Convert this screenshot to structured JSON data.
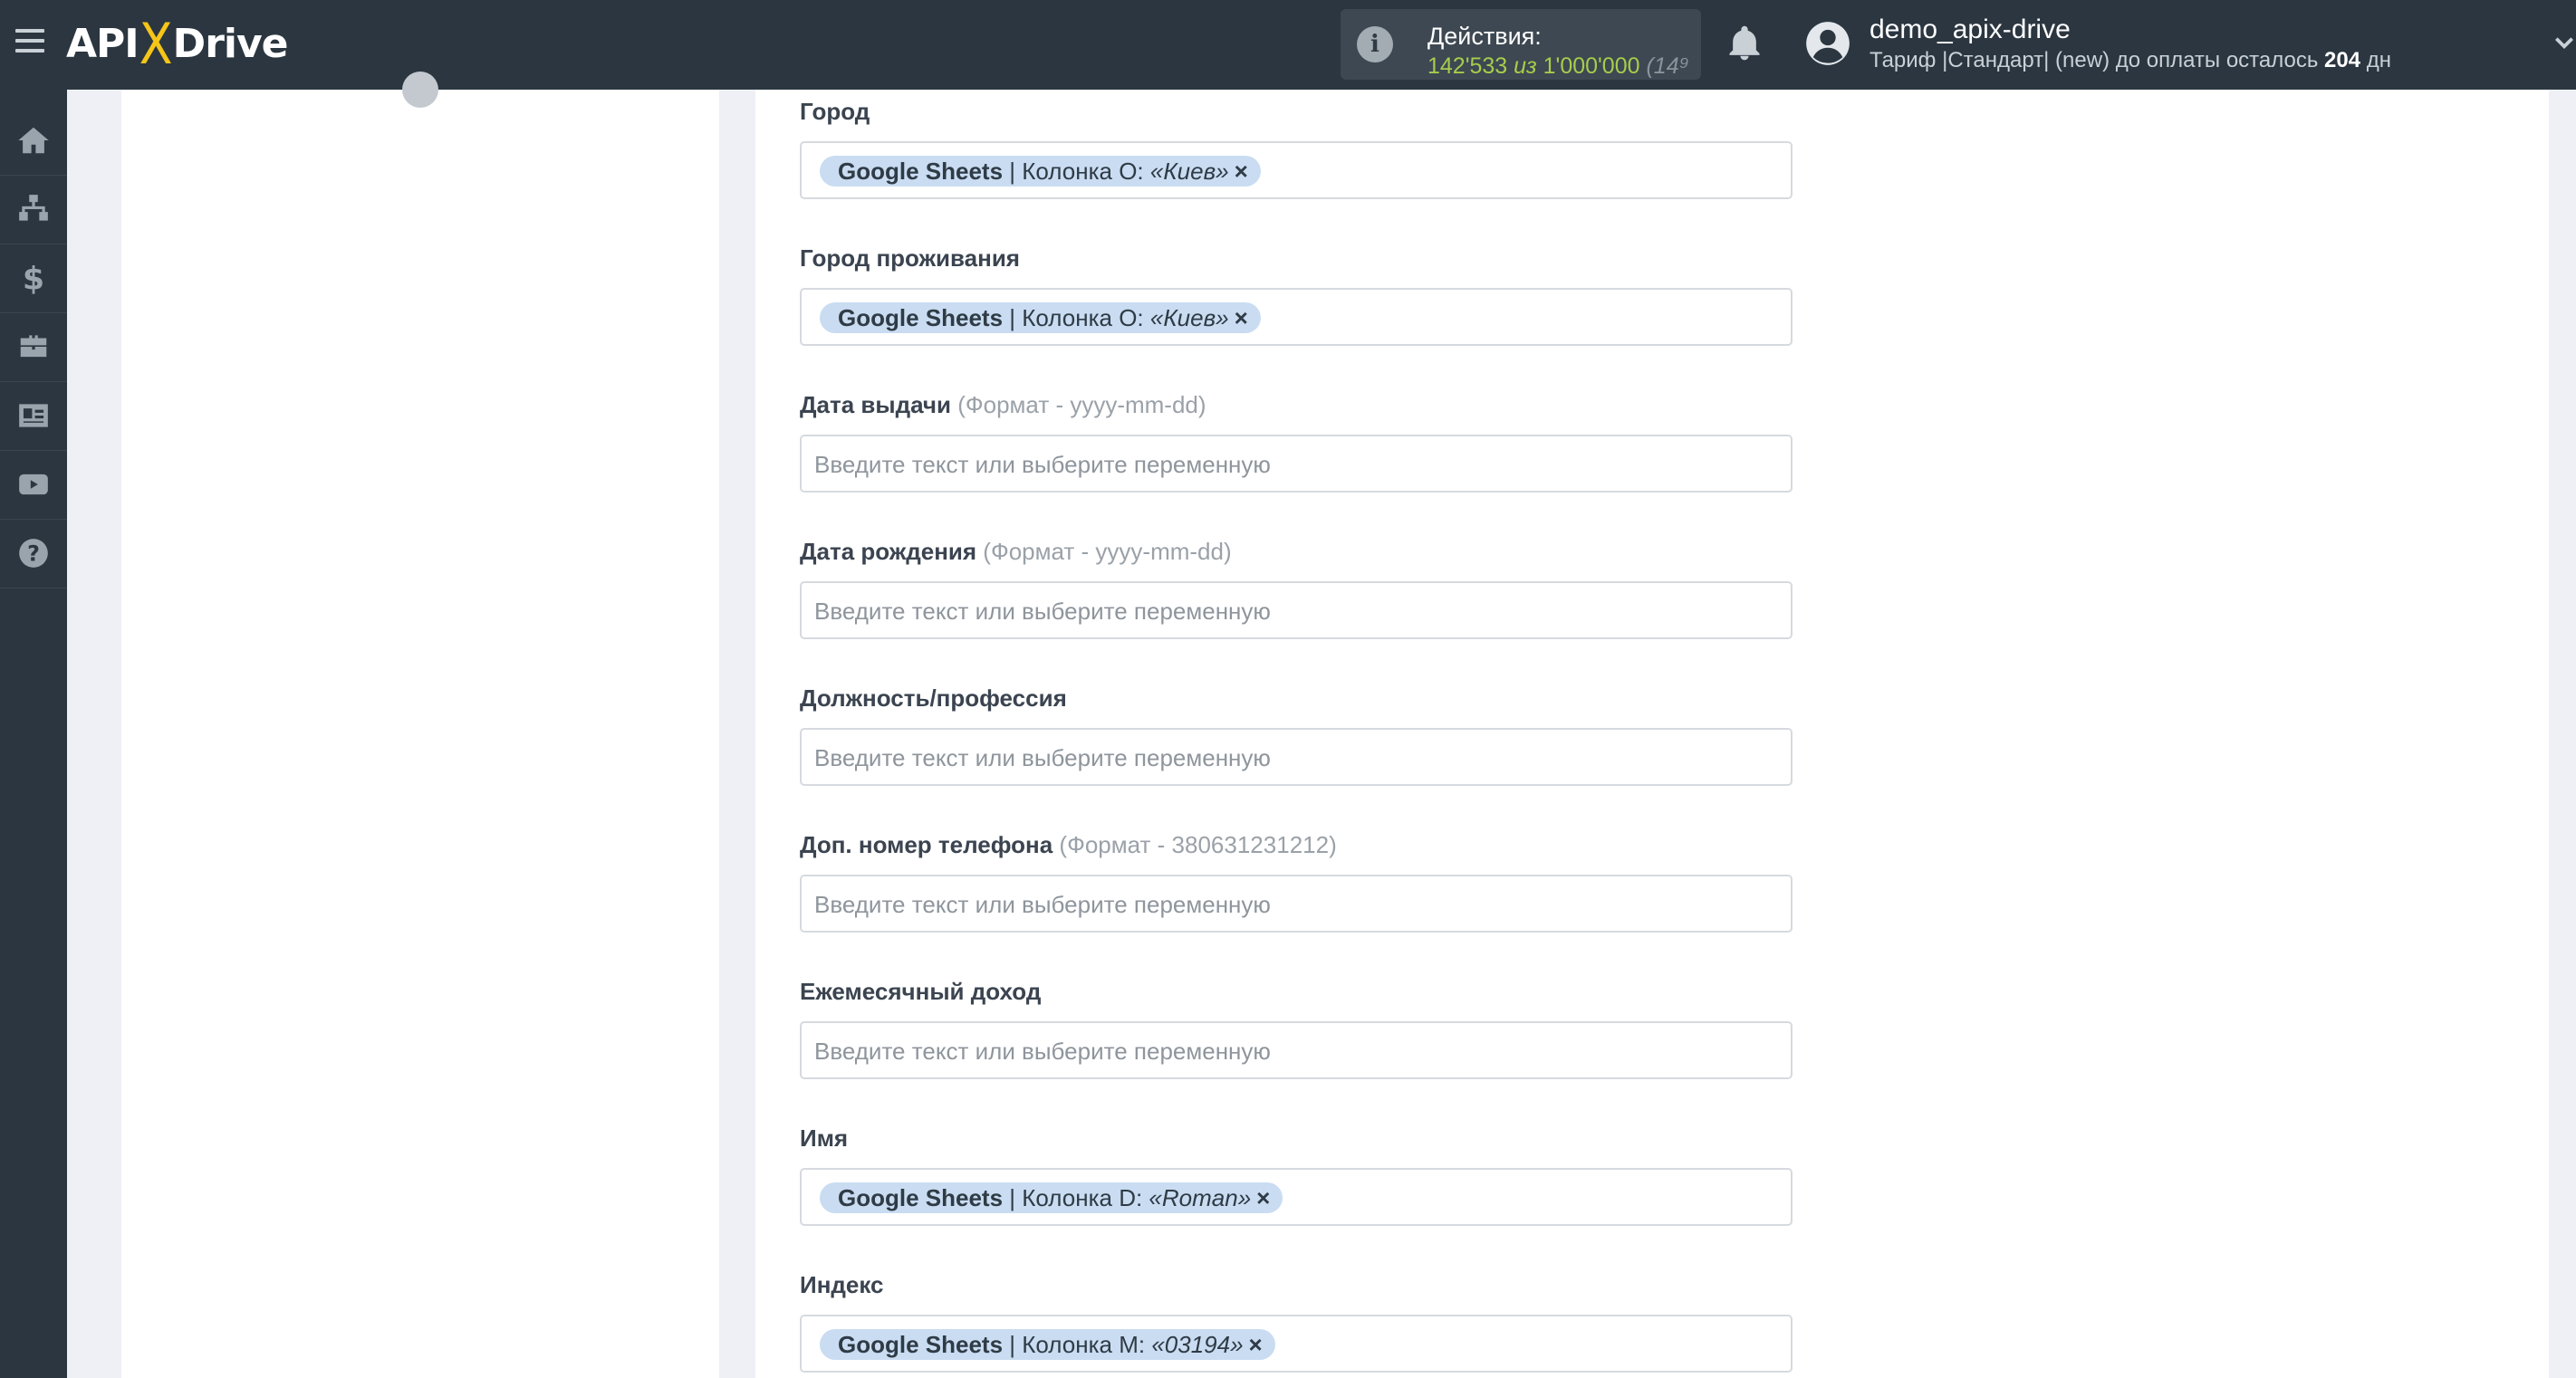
{
  "header": {
    "logo_left": "API",
    "logo_x": "X",
    "logo_right": "Drive",
    "actions_title": "Действия:",
    "actions_used": "142'533",
    "actions_of": "из",
    "actions_total": "1'000'000",
    "actions_rest": "(14⁹",
    "username": "demo_apix-drive",
    "tariff_prefix": "Тариф |Стандарт| (new) до оплаты осталось",
    "tariff_days": "204",
    "tariff_suffix": "дн"
  },
  "sidebar": {
    "items": [
      "home-icon",
      "sitemap-icon",
      "dollar-icon",
      "briefcase-icon",
      "id-card-icon",
      "video-icon",
      "help-icon"
    ]
  },
  "form": {
    "fields": [
      {
        "label": "Город",
        "hint": "",
        "tag": {
          "source": "Google Sheets",
          "column": " | Колонка O: ",
          "value": "«Киев»",
          "remove": "×"
        }
      },
      {
        "label": "Город проживания",
        "hint": "",
        "tag": {
          "source": "Google Sheets",
          "column": " | Колонка O: ",
          "value": "«Киев»",
          "remove": "×"
        }
      },
      {
        "label": "Дата выдачи",
        "hint": " (Формат - yyyy-mm-dd)",
        "placeholder": "Введите текст или выберите переменную"
      },
      {
        "label": "Дата рождения",
        "hint": " (Формат - yyyy-mm-dd)",
        "placeholder": "Введите текст или выберите переменную"
      },
      {
        "label": "Должность/профессия",
        "hint": "",
        "placeholder": "Введите текст или выберите переменную"
      },
      {
        "label": "Доп. номер телефона",
        "hint": " (Формат - 380631231212)",
        "placeholder": "Введите текст или выберите переменную"
      },
      {
        "label": "Ежемесячный доход",
        "hint": "",
        "placeholder": "Введите текст или выберите переменную"
      },
      {
        "label": "Имя",
        "hint": "",
        "tag": {
          "source": "Google Sheets",
          "column": " | Колонка D: ",
          "value": "«Roman»",
          "remove": "×"
        }
      },
      {
        "label": "Индекс",
        "hint": "",
        "tag": {
          "source": "Google Sheets",
          "column": " | Колонка M: ",
          "value": "«03194»",
          "remove": "×"
        }
      }
    ]
  },
  "colors": {
    "topbar": "#2b3640",
    "accent_yellow": "#f5c518",
    "actions_green": "#a7cc4c",
    "tag_bg": "#c9dcf2"
  }
}
